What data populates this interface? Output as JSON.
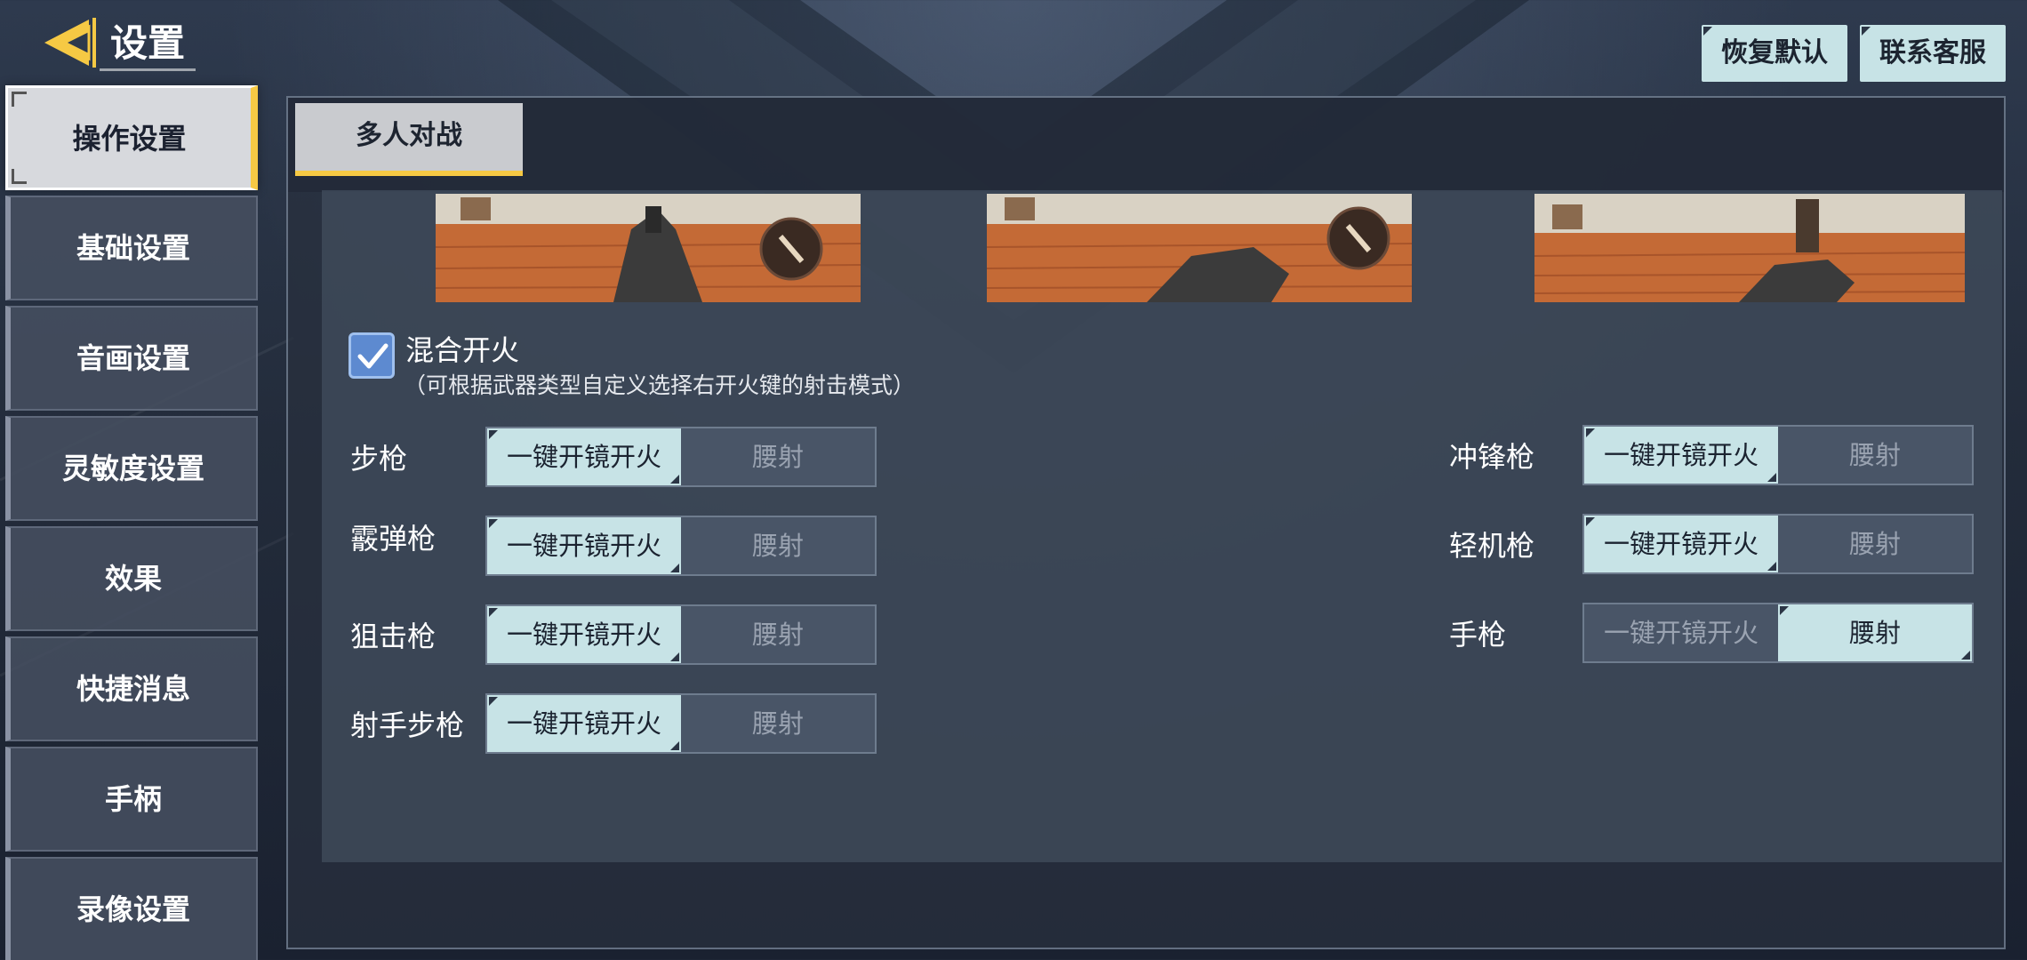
{
  "header": {
    "title": "设置",
    "restore_label": "恢复默认",
    "contact_label": "联系客服"
  },
  "sidebar": {
    "items": [
      {
        "label": "操作设置",
        "active": true
      },
      {
        "label": "基础设置",
        "active": false
      },
      {
        "label": "音画设置",
        "active": false
      },
      {
        "label": "灵敏度设置",
        "active": false
      },
      {
        "label": "效果",
        "active": false
      },
      {
        "label": "快捷消息",
        "active": false
      },
      {
        "label": "手柄",
        "active": false
      },
      {
        "label": "录像设置",
        "active": false
      }
    ]
  },
  "tabs": [
    {
      "label": "多人对战",
      "active": true
    }
  ],
  "mixed_fire": {
    "checked": true,
    "label": "混合开火",
    "description": "（可根据武器类型自定义选择右开火键的射击模式）"
  },
  "weapons_left": [
    {
      "name": "步枪",
      "option_a": "一键开镜开火",
      "option_b": "腰射",
      "selected": "option_a"
    },
    {
      "name": "霰弹枪",
      "option_a": "一键开镜开火",
      "option_b": "腰射",
      "selected": "option_a"
    },
    {
      "name": "狙击枪",
      "option_a": "一键开镜开火",
      "option_b": "腰射",
      "selected": "option_a"
    },
    {
      "name": "射手步枪",
      "option_a": "一键开镜开火",
      "option_b": "腰射",
      "selected": "option_a"
    }
  ],
  "weapons_right": [
    {
      "name": "冲锋枪",
      "option_a": "一键开镜开火",
      "option_b": "腰射",
      "selected": "option_a"
    },
    {
      "name": "轻机枪",
      "option_a": "一键开镜开火",
      "option_b": "腰射",
      "selected": "option_a"
    },
    {
      "name": "手枪",
      "option_a": "一键开镜开火",
      "option_b": "腰射",
      "selected": "option_b"
    }
  ],
  "colors": {
    "accent_yellow": "#f6c944",
    "selected_option": "#c7e3e6",
    "checkbox_blue": "#5d8ad0"
  }
}
